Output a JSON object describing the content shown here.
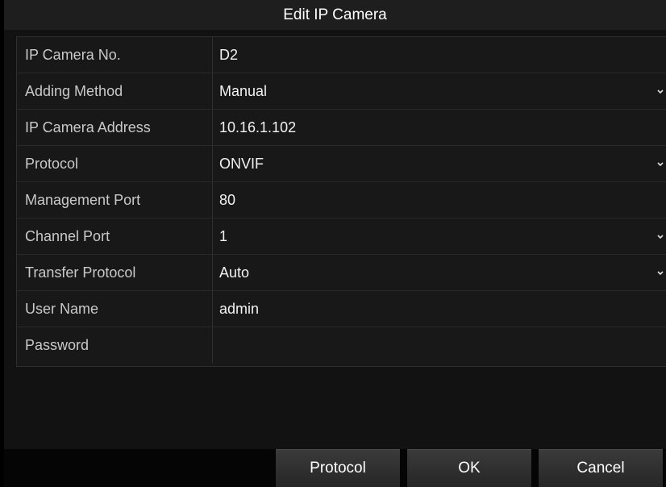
{
  "dialog": {
    "title": "Edit IP Camera"
  },
  "fields": [
    {
      "label": "IP Camera No.",
      "value": "D2",
      "dropdown": false
    },
    {
      "label": "Adding Method",
      "value": "Manual",
      "dropdown": true
    },
    {
      "label": "IP Camera Address",
      "value": "10.16.1.102",
      "dropdown": false
    },
    {
      "label": "Protocol",
      "value": "ONVIF",
      "dropdown": true
    },
    {
      "label": "Management Port",
      "value": "80",
      "dropdown": false
    },
    {
      "label": "Channel Port",
      "value": "1",
      "dropdown": true
    },
    {
      "label": "Transfer Protocol",
      "value": "Auto",
      "dropdown": true
    },
    {
      "label": "User Name",
      "value": "admin",
      "dropdown": false
    },
    {
      "label": "Password",
      "value": "",
      "dropdown": false
    }
  ],
  "buttons": {
    "protocol": "Protocol",
    "ok": "OK",
    "cancel": "Cancel"
  },
  "icons": {
    "dropdown": "chevron-down-icon"
  },
  "colors": {
    "background": "#121212",
    "title_bar": "#1e1e1e",
    "label_text": "#c9c9c9",
    "value_text": "#f2f2f2"
  }
}
